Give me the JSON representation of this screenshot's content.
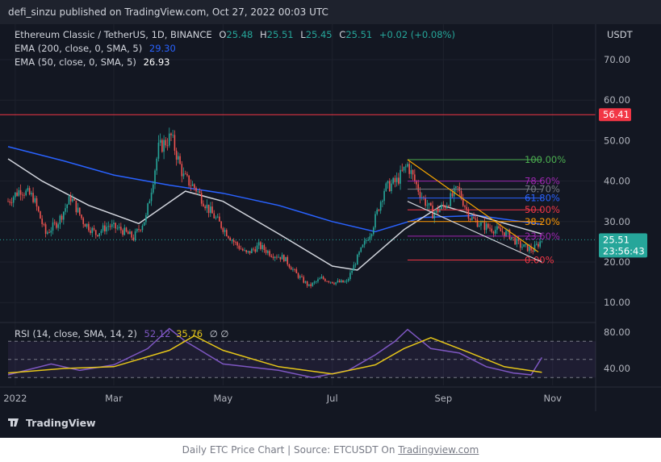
{
  "header": "defi_sinzu published on TradingView.com, Oct 27, 2022 00:03 UTC",
  "legend": {
    "symbol": "Ethereum Classic / TetherUS, 1D, BINANCE",
    "o_label": "O",
    "o": "25.48",
    "h_label": "H",
    "h": "25.51",
    "l_label": "L",
    "l": "25.45",
    "c_label": "C",
    "c": "25.51",
    "change": "+0.02 (+0.08%)",
    "ema200_label": "EMA (200, close, 0, SMA, 5)",
    "ema200_value": "29.30",
    "ema50_label": "EMA (50, close, 0, SMA, 5)",
    "ema50_value": "26.93"
  },
  "rsi_legend": {
    "label": "RSI (14, close, SMA, 14, 2)",
    "rsi": "52.12",
    "sma": "35.76",
    "extra": "∅ ∅"
  },
  "logo": "TradingView",
  "caption": {
    "prefix": "Daily ETC Price Chart | Source: ETCUSDT On ",
    "link": "Tradingview.com"
  },
  "colors": {
    "background": "#131722",
    "up": "#26a69a",
    "down": "#ef5350",
    "ema200": "#2962ff",
    "ema50": "#d1d4dc",
    "rsi": "#7e57c2",
    "rsi_ma": "#e6c619",
    "resistance": "#f23645",
    "trendline": "#f7a600"
  },
  "chart_data": {
    "type": "candlestick",
    "currency": "USDT",
    "price_axis_ticks": [
      "70.00",
      "60.00",
      "50.00",
      "40.00",
      "30.00",
      "20.00",
      "10.00"
    ],
    "time_axis_labels": [
      "2022",
      "Mar",
      "May",
      "Jul",
      "Sep",
      "Nov"
    ],
    "ylim": [
      5,
      78
    ],
    "xlim": [
      "2022-01-01",
      "2022-11-25"
    ],
    "last_price": {
      "value": "25.51",
      "countdown": "23:56:43"
    },
    "resistance": {
      "value": "56.41"
    },
    "fibonacci": {
      "start": "2022-08-12",
      "end": "2022-10-26",
      "levels": [
        {
          "label": "100.00%",
          "value": 45.3,
          "color": "#4caf50"
        },
        {
          "label": "78.60%",
          "value": 40.0,
          "color": "#9c27b0"
        },
        {
          "label": "70.70%",
          "value": 38.0,
          "color": "#787b86"
        },
        {
          "label": "61.80%",
          "value": 35.8,
          "color": "#2962ff"
        },
        {
          "label": "50.00%",
          "value": 32.9,
          "color": "#f23645"
        },
        {
          "label": "38.20%",
          "value": 30.0,
          "color": "#ff9800"
        },
        {
          "label": "23.60%",
          "value": 26.4,
          "color": "#9c27b0"
        },
        {
          "label": "0.00%",
          "value": 20.5,
          "color": "#f23645"
        }
      ]
    },
    "wedge": {
      "upper": [
        [
          "2022-08-12",
          45.3
        ],
        [
          "2022-10-24",
          22.5
        ]
      ],
      "lower": [
        [
          "2022-08-12",
          35.0
        ],
        [
          "2022-10-26",
          20.0
        ]
      ]
    },
    "price_path": [
      [
        "2022-01-01",
        35
      ],
      [
        "2022-01-08",
        38
      ],
      [
        "2022-01-15",
        36
      ],
      [
        "2022-01-22",
        27
      ],
      [
        "2022-01-29",
        30
      ],
      [
        "2022-02-05",
        36
      ],
      [
        "2022-02-12",
        30
      ],
      [
        "2022-02-19",
        27
      ],
      [
        "2022-02-26",
        29
      ],
      [
        "2022-03-05",
        28
      ],
      [
        "2022-03-12",
        26
      ],
      [
        "2022-03-19",
        31
      ],
      [
        "2022-03-26",
        48
      ],
      [
        "2022-04-02",
        51
      ],
      [
        "2022-04-09",
        41
      ],
      [
        "2022-04-16",
        38
      ],
      [
        "2022-04-23",
        33
      ],
      [
        "2022-04-30",
        29
      ],
      [
        "2022-05-07",
        25
      ],
      [
        "2022-05-14",
        22
      ],
      [
        "2022-05-21",
        24
      ],
      [
        "2022-05-28",
        22
      ],
      [
        "2022-06-04",
        21
      ],
      [
        "2022-06-11",
        17
      ],
      [
        "2022-06-18",
        14
      ],
      [
        "2022-06-25",
        16
      ],
      [
        "2022-07-02",
        15
      ],
      [
        "2022-07-09",
        15
      ],
      [
        "2022-07-16",
        22
      ],
      [
        "2022-07-23",
        28
      ],
      [
        "2022-07-30",
        38
      ],
      [
        "2022-08-06",
        40
      ],
      [
        "2022-08-12",
        44
      ],
      [
        "2022-08-19",
        37
      ],
      [
        "2022-08-26",
        32
      ],
      [
        "2022-09-02",
        34
      ],
      [
        "2022-09-09",
        38
      ],
      [
        "2022-09-16",
        31
      ],
      [
        "2022-09-23",
        29
      ],
      [
        "2022-09-30",
        28
      ],
      [
        "2022-10-07",
        27
      ],
      [
        "2022-10-14",
        24
      ],
      [
        "2022-10-21",
        23
      ],
      [
        "2022-10-26",
        25.5
      ]
    ],
    "ema200": [
      [
        "2022-01-01",
        48.5
      ],
      [
        "2022-02-01",
        45
      ],
      [
        "2022-03-01",
        41.5
      ],
      [
        "2022-04-01",
        39
      ],
      [
        "2022-05-01",
        37
      ],
      [
        "2022-06-01",
        34
      ],
      [
        "2022-07-01",
        30
      ],
      [
        "2022-07-25",
        27.5
      ],
      [
        "2022-08-20",
        31
      ],
      [
        "2022-09-20",
        31.5
      ],
      [
        "2022-10-26",
        29.3
      ]
    ],
    "ema50": [
      [
        "2022-01-01",
        45.5
      ],
      [
        "2022-01-20",
        40
      ],
      [
        "2022-02-15",
        34
      ],
      [
        "2022-03-15",
        29.5
      ],
      [
        "2022-04-10",
        37.5
      ],
      [
        "2022-05-01",
        35
      ],
      [
        "2022-06-01",
        27
      ],
      [
        "2022-07-01",
        19
      ],
      [
        "2022-07-15",
        18
      ],
      [
        "2022-08-10",
        28
      ],
      [
        "2022-08-31",
        34
      ],
      [
        "2022-09-20",
        31.5
      ],
      [
        "2022-10-26",
        26.93
      ]
    ],
    "rsi": {
      "ticks": [
        "80.00",
        "40.00"
      ],
      "ylim": [
        20,
        90
      ],
      "bands": [
        70,
        50,
        30
      ],
      "rsi_path": [
        [
          "2022-01-01",
          33
        ],
        [
          "2022-01-25",
          45
        ],
        [
          "2022-02-10",
          38
        ],
        [
          "2022-03-01",
          44
        ],
        [
          "2022-03-20",
          62
        ],
        [
          "2022-04-01",
          84
        ],
        [
          "2022-04-10",
          70
        ],
        [
          "2022-05-01",
          45
        ],
        [
          "2022-06-01",
          38
        ],
        [
          "2022-06-20",
          30
        ],
        [
          "2022-07-10",
          38
        ],
        [
          "2022-07-25",
          55
        ],
        [
          "2022-08-05",
          70
        ],
        [
          "2022-08-12",
          83
        ],
        [
          "2022-08-25",
          62
        ],
        [
          "2022-09-10",
          57
        ],
        [
          "2022-09-25",
          42
        ],
        [
          "2022-10-10",
          35
        ],
        [
          "2022-10-20",
          33
        ],
        [
          "2022-10-26",
          52.12
        ]
      ],
      "sma_path": [
        [
          "2022-01-01",
          35
        ],
        [
          "2022-02-01",
          40
        ],
        [
          "2022-03-01",
          42
        ],
        [
          "2022-04-01",
          60
        ],
        [
          "2022-04-15",
          76
        ],
        [
          "2022-05-01",
          60
        ],
        [
          "2022-06-01",
          42
        ],
        [
          "2022-07-01",
          34
        ],
        [
          "2022-07-25",
          44
        ],
        [
          "2022-08-10",
          62
        ],
        [
          "2022-08-25",
          74
        ],
        [
          "2022-09-15",
          58
        ],
        [
          "2022-10-05",
          42
        ],
        [
          "2022-10-26",
          35.76
        ]
      ]
    }
  }
}
